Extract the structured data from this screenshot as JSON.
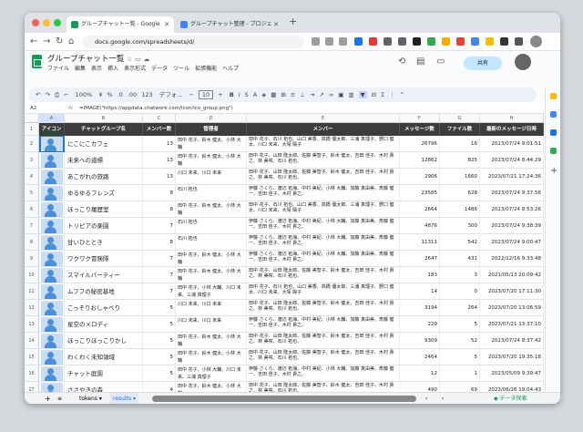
{
  "browser": {
    "tabs": [
      {
        "title": "グループチャット一覧 - Google"
      },
      {
        "title": "グループチャット整理 - プロジェ"
      }
    ],
    "url": "docs.google.com/spreadsheets/d/"
  },
  "doc": {
    "title": "グループチャット一覧",
    "menu": [
      "ファイル",
      "編集",
      "表示",
      "挿入",
      "表示形式",
      "データ",
      "ツール",
      "拡張機能",
      "ヘルプ"
    ],
    "share": "共有"
  },
  "toolbar": {
    "zoom": "100%",
    "currency": "¥",
    "percent": "%",
    "dec1": ".0",
    "dec2": ".00",
    "format123": "123",
    "font": "デフォ...",
    "size": "10"
  },
  "formula": {
    "cell": "A2",
    "fx": "fx",
    "value": "=IMAGE(\"https://appdata.chatwork.com/icon/ico_group.png\")"
  },
  "columns": [
    "A",
    "B",
    "C",
    "D",
    "E",
    "F",
    "G",
    "H"
  ],
  "headers": [
    "アイコン",
    "チャットグループ名",
    "メンバー数",
    "管理者",
    "メンバー",
    "メッセージ数",
    "ファイル数",
    "最新のメッセージ日時"
  ],
  "rows": [
    {
      "n": "2",
      "name": "にこにこカフェ",
      "count": "13",
      "admin": "田中 花子、鈴木 健太、小林 大輔",
      "members": "田中 花子、石川 拓也、山口 美香、高橋 優太郎、三浦 真理子、野口 健太、川口 未来、大塚 陽子",
      "msgs": "26796",
      "files": "16",
      "date": "2023/07/24 9:01:51"
    },
    {
      "n": "3",
      "name": "未来への道標",
      "count": "13",
      "admin": "田中 花子、鈴木 健太、小林 大輔",
      "members": "田中 花子、山田 隆太郎、佐藤 美智子、鈴木 健太、吉田 佳子、木村 貴之、林 美咲、石川 拓也、",
      "msgs": "12862",
      "files": "825",
      "date": "2023/07/24 8:44:29"
    },
    {
      "n": "4",
      "name": "あこがれの旅路",
      "count": "13",
      "admin": "川口 未来、川口 未来",
      "members": "田中 花子、山田 隆太郎、佐藤 美智子、鈴木 健太、吉田 佳子、木村 貴之、林 美咲、石川 拓也、",
      "msgs": "2906",
      "files": "1660",
      "date": "2023/07/21 17:24:36"
    },
    {
      "n": "5",
      "name": "ゆるゆるフレンズ",
      "count": "8",
      "admin": "石川 拓也",
      "members": "伊藤 さくら、渡辺 拓海、中村 美紀、小林 大輔、加藤 真由美、斎藤 健一、吉田 佳子、木村 貴之、",
      "msgs": "23585",
      "files": "628",
      "date": "2023/07/24 9:37:56"
    },
    {
      "n": "6",
      "name": "ほっこり履歴室",
      "count": "8",
      "admin": "田中 花子、鈴木 健太、小林 大輔",
      "members": "田中 花子、石川 拓也、山口 美香、高橋 優太郎、三浦 真理子、野口 健太、川口 未来、大塚 陽子",
      "msgs": "2664",
      "files": "1486",
      "date": "2023/07/24 8:53:26"
    },
    {
      "n": "7",
      "name": "トリピアの楽園",
      "count": "7",
      "admin": "石川 拓也",
      "members": "伊藤 さくら、渡辺 拓海、中村 美紀、小林 大輔、加藤 真由美、斎藤 健一、吉田 佳子、木村 貴之、",
      "msgs": "4876",
      "files": "300",
      "date": "2023/07/24 9:38:39"
    },
    {
      "n": "8",
      "name": "甘いひととき",
      "count": "8",
      "admin": "石川 拓也",
      "members": "伊藤 さくら、渡辺 拓海、中村 美紀、小林 大輔、加藤 真由美、斎藤 健一、吉田 佳子、木村 貴之、",
      "msgs": "11311",
      "files": "542",
      "date": "2023/07/24 9:00:47"
    },
    {
      "n": "9",
      "name": "ワクワク冒険隊",
      "count": "7",
      "admin": "田中 花子、鈴木 健太、小林 大輔",
      "members": "伊藤 さくら、渡辺 拓海、中村 美紀、小林 大輔、加藤 真由美、斎藤 健一、吉田 佳子、木村 貴之、",
      "msgs": "2647",
      "files": "431",
      "date": "2022/12/16 9:33:48"
    },
    {
      "n": "10",
      "name": "スマイルパーティー",
      "count": "7",
      "admin": "田中 花子、鈴木 健太、小林 大輔",
      "members": "田中 花子、山田 隆太郎、佐藤 美智子、鈴木 健太、吉田 佳子、木村 貴之、林 美咲、石川 拓也、",
      "msgs": "183",
      "files": "3",
      "date": "2021/05/13 20:09:42"
    },
    {
      "n": "11",
      "name": "ムフフの秘密基地",
      "count": "7",
      "admin": "田中 花子、小林 大輔、川口 未来、三浦 真理子",
      "members": "田中 花子、石川 拓也、山口 美香、高橋 優太郎、三浦 真理子、野口 健太、川口 未来、大塚 陽子",
      "msgs": "14",
      "files": "0",
      "date": "2023/07/20 17:11:30"
    },
    {
      "n": "12",
      "name": "こっそりおしゃべり",
      "count": "5",
      "admin": "川口 未来、川口 未来",
      "members": "田中 花子、山田 隆太郎、佐藤 美智子、鈴木 健太、吉田 佳子、木村 貴之、林 美咲、石川 拓也、",
      "msgs": "3194",
      "files": "264",
      "date": "2023/07/20 13:06:59"
    },
    {
      "n": "13",
      "name": "星空のメロディ",
      "count": "5",
      "admin": "川口 未来、川口 未来",
      "members": "伊藤 さくら、渡辺 拓海、中村 美紀、小林 大輔、加藤 真由美、斎藤 健一、吉田 佳子、木村 貴之、",
      "msgs": "220",
      "files": "5",
      "date": "2023/07/21 13:37:10"
    },
    {
      "n": "14",
      "name": "ほっこりほっこりかし",
      "count": "5",
      "admin": "田中 花子、鈴木 健太、小林 大輔",
      "members": "田中 花子、山田 隆太郎、佐藤 美智子、鈴木 健太、吉田 佳子、木村 貴之、林 美咲、石川 拓也、",
      "msgs": "9309",
      "files": "52",
      "date": "2023/07/24 8:37:42"
    },
    {
      "n": "15",
      "name": "わくわく未知領域",
      "count": "5",
      "admin": "田中 花子、鈴木 健太、小林 大輔",
      "members": "田中 花子、山田 隆太郎、佐藤 美智子、鈴木 健太、吉田 佳子、木村 貴之、林 美咲、石川 拓也、",
      "msgs": "2464",
      "files": "5",
      "date": "2023/07/20 19:35:18"
    },
    {
      "n": "16",
      "name": "チャット庭園",
      "count": "5",
      "admin": "田中 花子、小林 大輔、川口 未来、三浦 真理子",
      "members": "伊藤 さくら、渡辺 拓海、中村 美紀、小林 大輔、加藤 真由美、斎藤 健一、吉田 佳子、木村 貴之、",
      "msgs": "12",
      "files": "1",
      "date": "2023/05/09 9:39:47"
    },
    {
      "n": "17",
      "name": "ささやきの森",
      "count": "4",
      "admin": "田中 花子、鈴木 健太、小林 大輔",
      "members": "田中 花子、山田 隆太郎、佐藤 美智子、鈴木 健太、吉田 佳子、木村 貴之、林 美咲、石川 拓也、",
      "msgs": "490",
      "files": "69",
      "date": "2023/06/26 19:04:43"
    }
  ],
  "sheets": {
    "add": "+",
    "list": "≡",
    "tab1": "tokens",
    "tab2": "results",
    "explore": "データ探索"
  }
}
